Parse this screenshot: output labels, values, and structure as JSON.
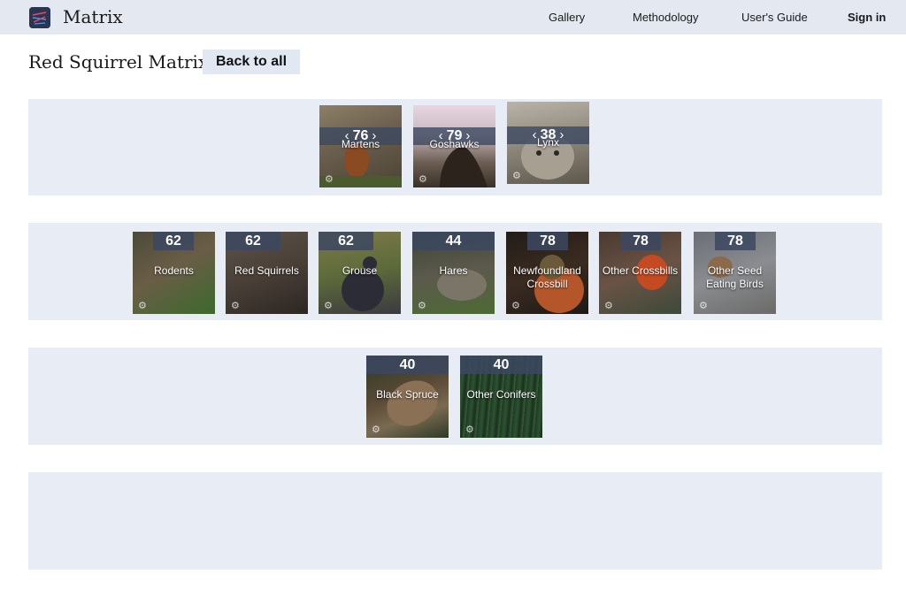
{
  "header": {
    "brand": "Matrix",
    "nav": [
      "Gallery",
      "Methodology",
      "User's Guide",
      "Sign in"
    ]
  },
  "page": {
    "title": "Red Squirrel Matrix",
    "back_label": "Back to all"
  },
  "rows": [
    [
      {
        "value": "76",
        "label": "Martens"
      },
      {
        "value": "79",
        "label": "Goshawks"
      },
      {
        "value": "38",
        "label": "Lynx"
      }
    ],
    [
      {
        "value": "62",
        "label": "Rodents"
      },
      {
        "value": "62",
        "label": "Red Squirrels"
      },
      {
        "value": "62",
        "label": "Grouse"
      },
      {
        "value": "44",
        "label": "Hares"
      },
      {
        "value": "78",
        "label": "Newfoundland Crossbill"
      },
      {
        "value": "78",
        "label": "Other Crossbills"
      },
      {
        "value": "78",
        "label": "Other Seed Eating Birds"
      }
    ],
    [
      {
        "value": "40",
        "label": "Black Spruce"
      },
      {
        "value": "40",
        "label": "Other Conifers"
      }
    ]
  ]
}
